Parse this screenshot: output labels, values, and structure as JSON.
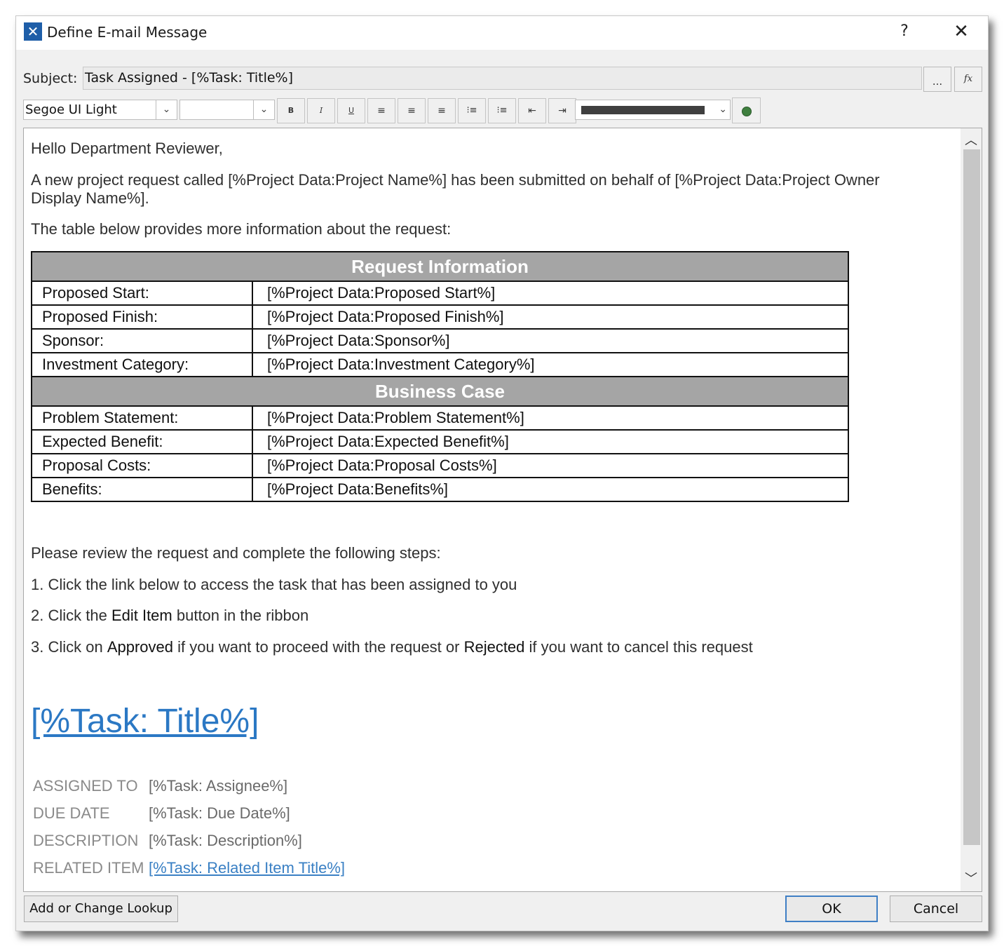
{
  "window": {
    "title": "Define E-mail Message",
    "help_label": "?",
    "close_label": "✕"
  },
  "subject": {
    "label": "Subject:",
    "value": "Task Assigned - [%Task: Title%]",
    "dots_label": "...",
    "fx_label": "fx"
  },
  "toolbar": {
    "font": "Segoe UI Light",
    "size": "",
    "buttons": [
      {
        "name": "bold-button",
        "label": "B"
      },
      {
        "name": "italic-button",
        "label": "I"
      },
      {
        "name": "underline-button",
        "label": "U"
      },
      {
        "name": "align-left-button",
        "label": "≡"
      },
      {
        "name": "align-center-button",
        "label": "≡"
      },
      {
        "name": "align-right-button",
        "label": "≡"
      },
      {
        "name": "numbered-list-button",
        "label": "⁝≡"
      },
      {
        "name": "bullet-list-button",
        "label": "⁝≡"
      },
      {
        "name": "decrease-indent-button",
        "label": "⇤"
      },
      {
        "name": "increase-indent-button",
        "label": "⇥"
      }
    ],
    "color": "#3f3f3f"
  },
  "body": {
    "greeting": "Hello Department Reviewer,",
    "intro_line1": "A new project request called [%Project Data:Project Name%] has been submitted on behalf of [%Project Data:Project Owner",
    "intro_line2": "Display Name%].",
    "table_intro": "The table below provides more information about the request:",
    "table": {
      "section1_title": "Request Information",
      "section1_rows": [
        {
          "label": "Proposed Start:",
          "value": "[%Project Data:Proposed Start%]"
        },
        {
          "label": "Proposed Finish:",
          "value": "[%Project Data:Proposed Finish%]"
        },
        {
          "label": "Sponsor:",
          "value": "[%Project Data:Sponsor%]"
        },
        {
          "label": "Investment Category:",
          "value": "[%Project Data:Investment Category%]"
        }
      ],
      "section2_title": "Business Case",
      "section2_rows": [
        {
          "label": "Problem Statement:",
          "value": "[%Project Data:Problem Statement%]"
        },
        {
          "label": "Expected Benefit:",
          "value": "[%Project Data:Expected Benefit%]"
        },
        {
          "label": "Proposal Costs:",
          "value": "[%Project Data:Proposal Costs%]"
        },
        {
          "label": "Benefits:",
          "value": "[%Project Data:Benefits%]"
        }
      ]
    },
    "steps_intro": "Please review the request and complete the following steps:",
    "step1": "1. Click the link below to access the task that has been assigned to you",
    "step2_pre": "2. Click the ",
    "step2_bold": "Edit Item",
    "step2_post": " button in the ribbon",
    "step3_pre": "3. Click on ",
    "step3_bold1": "Approved",
    "step3_mid": " if you want to proceed with the request or ",
    "step3_bold2": "Rejected",
    "step3_post": " if you want to cancel this request",
    "task_link": "[%Task: Title%]",
    "meta": [
      {
        "label": "ASSIGNED TO",
        "value": "[%Task: Assignee%]"
      },
      {
        "label": "DUE DATE",
        "value": "[%Task: Due Date%]"
      },
      {
        "label": "DESCRIPTION",
        "value": "[%Task: Description%]"
      },
      {
        "label": "RELATED ITEM",
        "value": "[%Task: Related Item Title%]"
      }
    ]
  },
  "footer": {
    "lookup_label": "Add or Change Lookup",
    "ok_label": "OK",
    "cancel_label": "Cancel"
  }
}
